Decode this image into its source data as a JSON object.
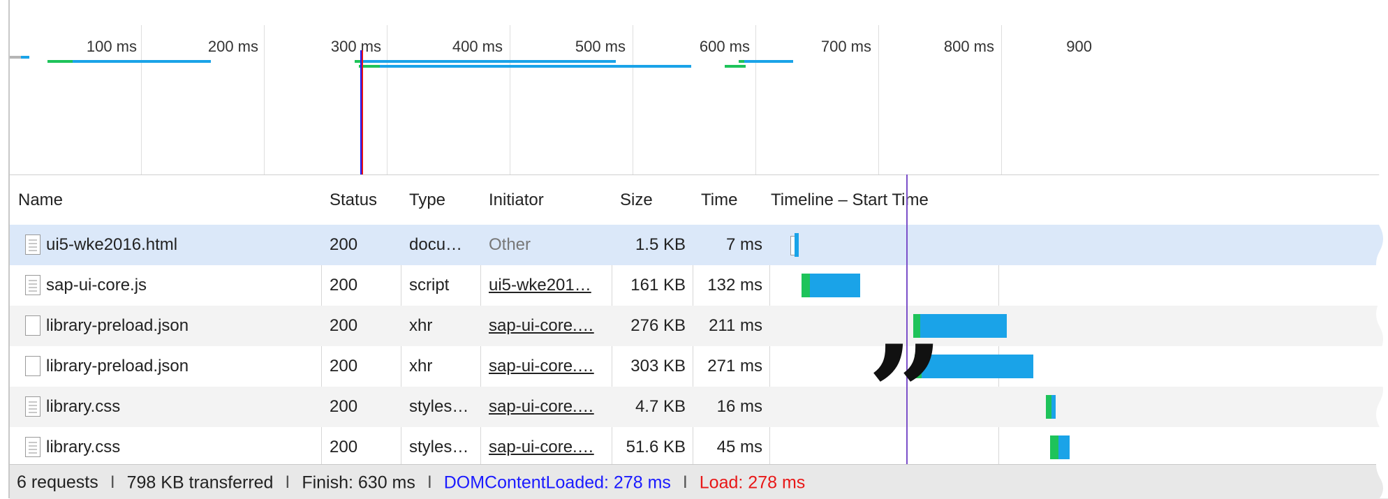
{
  "overview": {
    "ticks": [
      "100 ms",
      "200 ms",
      "300 ms",
      "400 ms",
      "500 ms",
      "600 ms",
      "700 ms",
      "800 ms",
      "900"
    ]
  },
  "table": {
    "columns": [
      "Name",
      "Status",
      "Type",
      "Initiator",
      "Size",
      "Time",
      "Timeline – Start Time"
    ],
    "rows": [
      {
        "name": "ui5-wke2016.html",
        "status": "200",
        "type": "docu…",
        "initiator": "Other",
        "size": "1.5 KB",
        "time": "7 ms",
        "icon": "document-icon"
      },
      {
        "name": "sap-ui-core.js",
        "status": "200",
        "type": "script",
        "initiator": "ui5-wke201…",
        "size": "161 KB",
        "time": "132 ms",
        "icon": "script-file-icon"
      },
      {
        "name": "library-preload.json",
        "status": "200",
        "type": "xhr",
        "initiator": "sap-ui-core.…",
        "size": "276 KB",
        "time": "211 ms",
        "icon": "blank-file-icon"
      },
      {
        "name": "library-preload.json",
        "status": "200",
        "type": "xhr",
        "initiator": "sap-ui-core.…",
        "size": "303 KB",
        "time": "271 ms",
        "icon": "blank-file-icon"
      },
      {
        "name": "library.css",
        "status": "200",
        "type": "styles…",
        "initiator": "sap-ui-core.…",
        "size": "4.7 KB",
        "time": "16 ms",
        "icon": "stylesheet-file-icon"
      },
      {
        "name": "library.css",
        "status": "200",
        "type": "styles…",
        "initiator": "sap-ui-core.…",
        "size": "51.6 KB",
        "time": "45 ms",
        "icon": "stylesheet-file-icon"
      }
    ]
  },
  "statusbar": {
    "requests": "6 requests",
    "transferred": "798 KB transferred",
    "finish": "Finish: 630 ms",
    "dom_content_loaded": "DOMContentLoaded: 278 ms",
    "load": "Load: 278 ms",
    "separator": "I"
  },
  "colors": {
    "waiting": "#1ec35a",
    "receiving": "#1aa3e8",
    "dom_content_loaded": "#1a1aff",
    "load": "#e81818",
    "marker": "#7b4fc9",
    "selected_row": "#dbe8f9"
  },
  "icons": {
    "overlay": "quote-mark-icon"
  }
}
